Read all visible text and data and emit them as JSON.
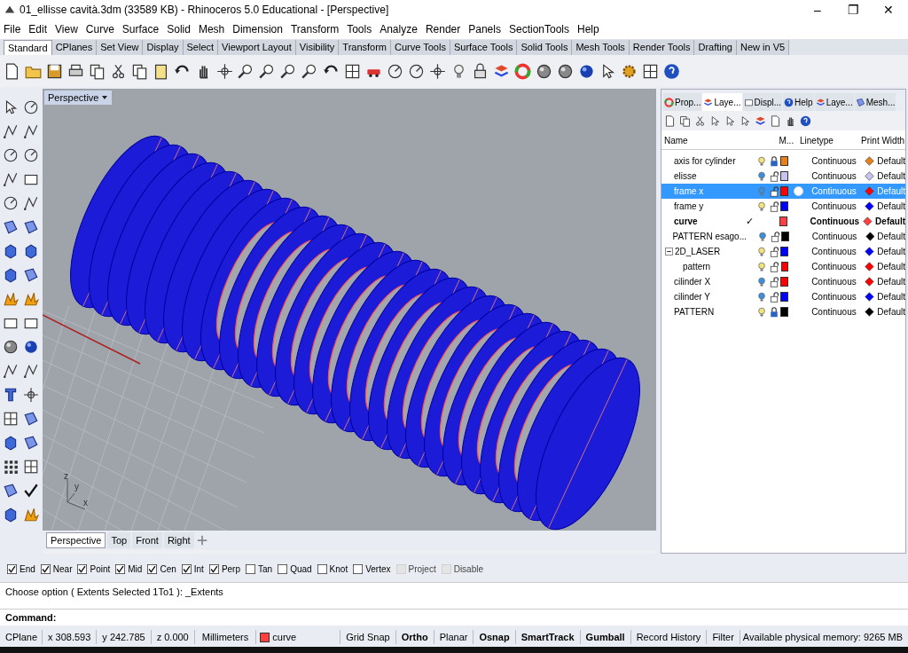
{
  "window": {
    "title": "01_ellisse cavità.3dm (33589 KB) - Rhinoceros 5.0 Educational - [Perspective]",
    "controls": [
      "–",
      "❐",
      "✕"
    ]
  },
  "menu": [
    "File",
    "Edit",
    "View",
    "Curve",
    "Surface",
    "Solid",
    "Mesh",
    "Dimension",
    "Transform",
    "Tools",
    "Analyze",
    "Render",
    "Panels",
    "SectionTools",
    "Help"
  ],
  "toolbar_tabs": [
    {
      "label": "Standard",
      "selected": true
    },
    {
      "label": "CPlanes",
      "selected": false
    },
    {
      "label": "Set View",
      "selected": false
    },
    {
      "label": "Display",
      "selected": false
    },
    {
      "label": "Select",
      "selected": false
    },
    {
      "label": "Viewport Layout",
      "selected": false
    },
    {
      "label": "Visibility",
      "selected": false
    },
    {
      "label": "Transform",
      "selected": false
    },
    {
      "label": "Curve Tools",
      "selected": false
    },
    {
      "label": "Surface Tools",
      "selected": false
    },
    {
      "label": "Solid Tools",
      "selected": false
    },
    {
      "label": "Mesh Tools",
      "selected": false
    },
    {
      "label": "Render Tools",
      "selected": false
    },
    {
      "label": "Drafting",
      "selected": false
    },
    {
      "label": "New in V5",
      "selected": false
    }
  ],
  "viewport": {
    "title": "Perspective",
    "axis_labels": [
      "z",
      "y",
      "x"
    ],
    "tabs": [
      {
        "label": "Perspective",
        "selected": true
      },
      {
        "label": "Top",
        "selected": false
      },
      {
        "label": "Front",
        "selected": false
      },
      {
        "label": "Right",
        "selected": false
      }
    ]
  },
  "panel": {
    "tabs": [
      {
        "label": "Prop...",
        "selected": false
      },
      {
        "label": "Laye...",
        "selected": true
      },
      {
        "label": "Displ...",
        "selected": false
      },
      {
        "label": "Help",
        "selected": false
      },
      {
        "label": "Laye...",
        "selected": false
      },
      {
        "label": "Mesh...",
        "selected": false
      }
    ],
    "columns": [
      "Name",
      "M...",
      "Linetype",
      "Print Width"
    ],
    "layers": [
      {
        "name": "axis for cylinder",
        "on": true,
        "locked": true,
        "color": "#e8801c",
        "material": false,
        "current": false,
        "selected": false,
        "linetype": "Continuous",
        "print_width": "Default"
      },
      {
        "name": "elisse",
        "on": false,
        "locked": false,
        "color": "#c8c4f0",
        "material": false,
        "current": false,
        "selected": false,
        "linetype": "Continuous",
        "print_width": "Default"
      },
      {
        "name": "frame x",
        "on": false,
        "locked": false,
        "color": "#ff0000",
        "material": true,
        "current": false,
        "selected": true,
        "linetype": "Continuous",
        "print_width": "Default"
      },
      {
        "name": "frame y",
        "on": true,
        "locked": false,
        "color": "#0000ff",
        "material": false,
        "current": false,
        "selected": false,
        "linetype": "Continuous",
        "print_width": "Default"
      },
      {
        "name": "curve",
        "current_mark": "✓",
        "color": "#ff4040",
        "current": true,
        "selected": false,
        "linetype": "Continuous",
        "print_width": "Default"
      },
      {
        "name": "PATTERN esago...",
        "on": false,
        "locked": false,
        "color": "#000000",
        "material": false,
        "current": false,
        "selected": false,
        "linetype": "Continuous",
        "print_width": "Default"
      },
      {
        "name": "2D_LASER",
        "expanded": true,
        "on": true,
        "locked": false,
        "color": "#0000ff",
        "material": false,
        "current": false,
        "selected": false,
        "linetype": "Continuous",
        "print_width": "Default",
        "children": [
          {
            "name": "pattern",
            "on": true,
            "locked": false,
            "color": "#ff0000",
            "material": false,
            "current": false,
            "selected": false,
            "linetype": "Continuous",
            "print_width": "Default"
          }
        ]
      },
      {
        "name": "cilinder X",
        "on": false,
        "locked": false,
        "color": "#ff0000",
        "material": false,
        "current": false,
        "selected": false,
        "linetype": "Continuous",
        "print_width": "Default"
      },
      {
        "name": "cilinder Y",
        "on": false,
        "locked": false,
        "color": "#0000ff",
        "material": false,
        "current": false,
        "selected": false,
        "linetype": "Continuous",
        "print_width": "Default"
      },
      {
        "name": "PATTERN",
        "on": true,
        "locked": true,
        "color": "#000000",
        "material": false,
        "current": false,
        "selected": false,
        "linetype": "Continuous",
        "print_width": "Default"
      }
    ]
  },
  "osnaps": [
    {
      "label": "End",
      "checked": true,
      "disabled": false
    },
    {
      "label": "Near",
      "checked": true,
      "disabled": false
    },
    {
      "label": "Point",
      "checked": true,
      "disabled": false
    },
    {
      "label": "Mid",
      "checked": true,
      "disabled": false
    },
    {
      "label": "Cen",
      "checked": true,
      "disabled": false
    },
    {
      "label": "Int",
      "checked": true,
      "disabled": false
    },
    {
      "label": "Perp",
      "checked": true,
      "disabled": false
    },
    {
      "label": "Tan",
      "checked": false,
      "disabled": false
    },
    {
      "label": "Quad",
      "checked": false,
      "disabled": false
    },
    {
      "label": "Knot",
      "checked": false,
      "disabled": false
    },
    {
      "label": "Vertex",
      "checked": false,
      "disabled": false
    },
    {
      "label": "Project",
      "checked": false,
      "disabled": true
    },
    {
      "label": "Disable",
      "checked": false,
      "disabled": true
    }
  ],
  "command_history": "Choose option ( Extents  Selected  1To1 ): _Extents",
  "command_prompt": "Command:",
  "status_bar": {
    "cplane": "CPlane",
    "x": "x 308.593",
    "y": "y 242.785",
    "z": "z 0.000",
    "units": "Millimeters",
    "layer": "curve",
    "toggles": [
      {
        "label": "Grid Snap",
        "on": false
      },
      {
        "label": "Ortho",
        "on": true
      },
      {
        "label": "Planar",
        "on": false
      },
      {
        "label": "Osnap",
        "on": true
      },
      {
        "label": "SmartTrack",
        "on": true
      },
      {
        "label": "Gumball",
        "on": true
      },
      {
        "label": "Record History",
        "on": false
      },
      {
        "label": "Filter",
        "on": false
      }
    ],
    "memory": "Available physical memory: 9265 MB"
  }
}
